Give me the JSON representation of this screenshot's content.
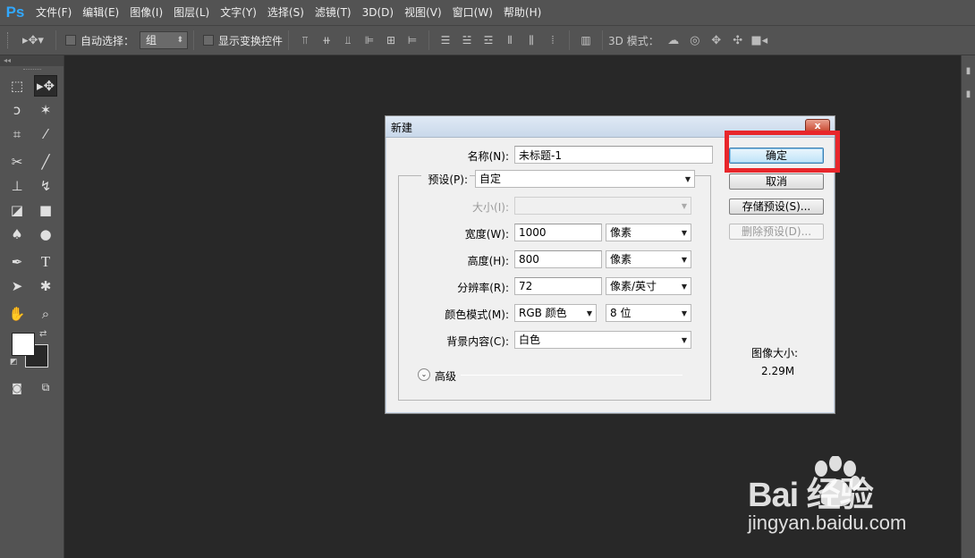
{
  "app": {
    "logo": "Ps"
  },
  "menubar": {
    "items": [
      "文件(F)",
      "编辑(E)",
      "图像(I)",
      "图层(L)",
      "文字(Y)",
      "选择(S)",
      "滤镜(T)",
      "3D(D)",
      "视图(V)",
      "窗口(W)",
      "帮助(H)"
    ]
  },
  "options": {
    "tool_icon": "move-tool-icon",
    "auto_select_label": "自动选择：",
    "auto_select_value": "组",
    "show_transform_label": "显示变换控件",
    "mode3d_label": "3D 模式："
  },
  "dialog": {
    "title": "新建",
    "close_label": "x",
    "name_label": "名称(N):",
    "name_value": "未标题-1",
    "preset_label": "预设(P):",
    "preset_value": "自定",
    "size_label": "大小(I):",
    "size_value": "",
    "width_label": "宽度(W):",
    "width_value": "1000",
    "width_unit": "像素",
    "height_label": "高度(H):",
    "height_value": "800",
    "height_unit": "像素",
    "resolution_label": "分辨率(R):",
    "resolution_value": "72",
    "resolution_unit": "像素/英寸",
    "color_mode_label": "颜色模式(M):",
    "color_mode_value": "RGB 颜色",
    "bit_depth_value": "8 位",
    "bg_label": "背景内容(C):",
    "bg_value": "白色",
    "advanced_label": "高级",
    "ok_label": "确定",
    "cancel_label": "取消",
    "save_preset_label": "存储预设(S)...",
    "delete_preset_label": "删除预设(D)...",
    "image_size_label": "图像大小:",
    "image_size_value": "2.29M"
  },
  "colors": {
    "highlight": "#e8262b",
    "foreground": "#ffffff",
    "background": "#282828",
    "ps_blue": "#31a8ff"
  },
  "watermark": {
    "brand": "Bai  经验",
    "url": "jingyan.baidu.com"
  }
}
